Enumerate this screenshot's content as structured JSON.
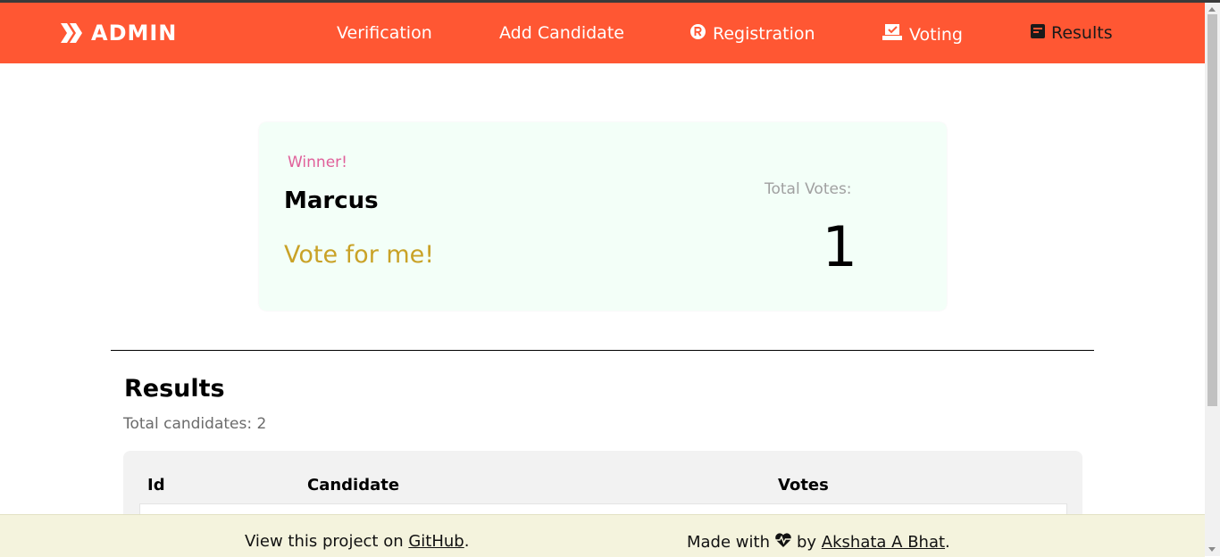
{
  "navbar": {
    "brand": "ADMIN",
    "brand_icon": "chevrons-logo-icon",
    "items": [
      {
        "label": "Verification",
        "icon": null,
        "active": false
      },
      {
        "label": "Add Candidate",
        "icon": null,
        "active": false
      },
      {
        "label": "Registration",
        "icon": "registered-icon",
        "active": false
      },
      {
        "label": "Voting",
        "icon": "ballot-box-icon",
        "active": false
      },
      {
        "label": "Results",
        "icon": "results-icon",
        "active": true
      }
    ]
  },
  "winner": {
    "label": "Winner!",
    "name": "Marcus",
    "slogan": "Vote for me!",
    "votes_label": "Total Votes:",
    "votes": "1"
  },
  "results": {
    "title": "Results",
    "total_label": "Total candidates:",
    "total_count": "2",
    "columns": [
      "Id",
      "Candidate",
      "Votes"
    ]
  },
  "footer": {
    "left_text": "View this project on",
    "left_link": "GitHub",
    "left_suffix": ".",
    "right_prefix": "Made with",
    "right_by": "by",
    "right_link": "Akshata A Bhat",
    "right_suffix": "."
  },
  "colors": {
    "navbar": "#ff5733",
    "winner_label": "#e0609a",
    "slogan": "#c9a227",
    "card_bg": "#f3fff8",
    "footer_bg": "#f4f3dd"
  }
}
